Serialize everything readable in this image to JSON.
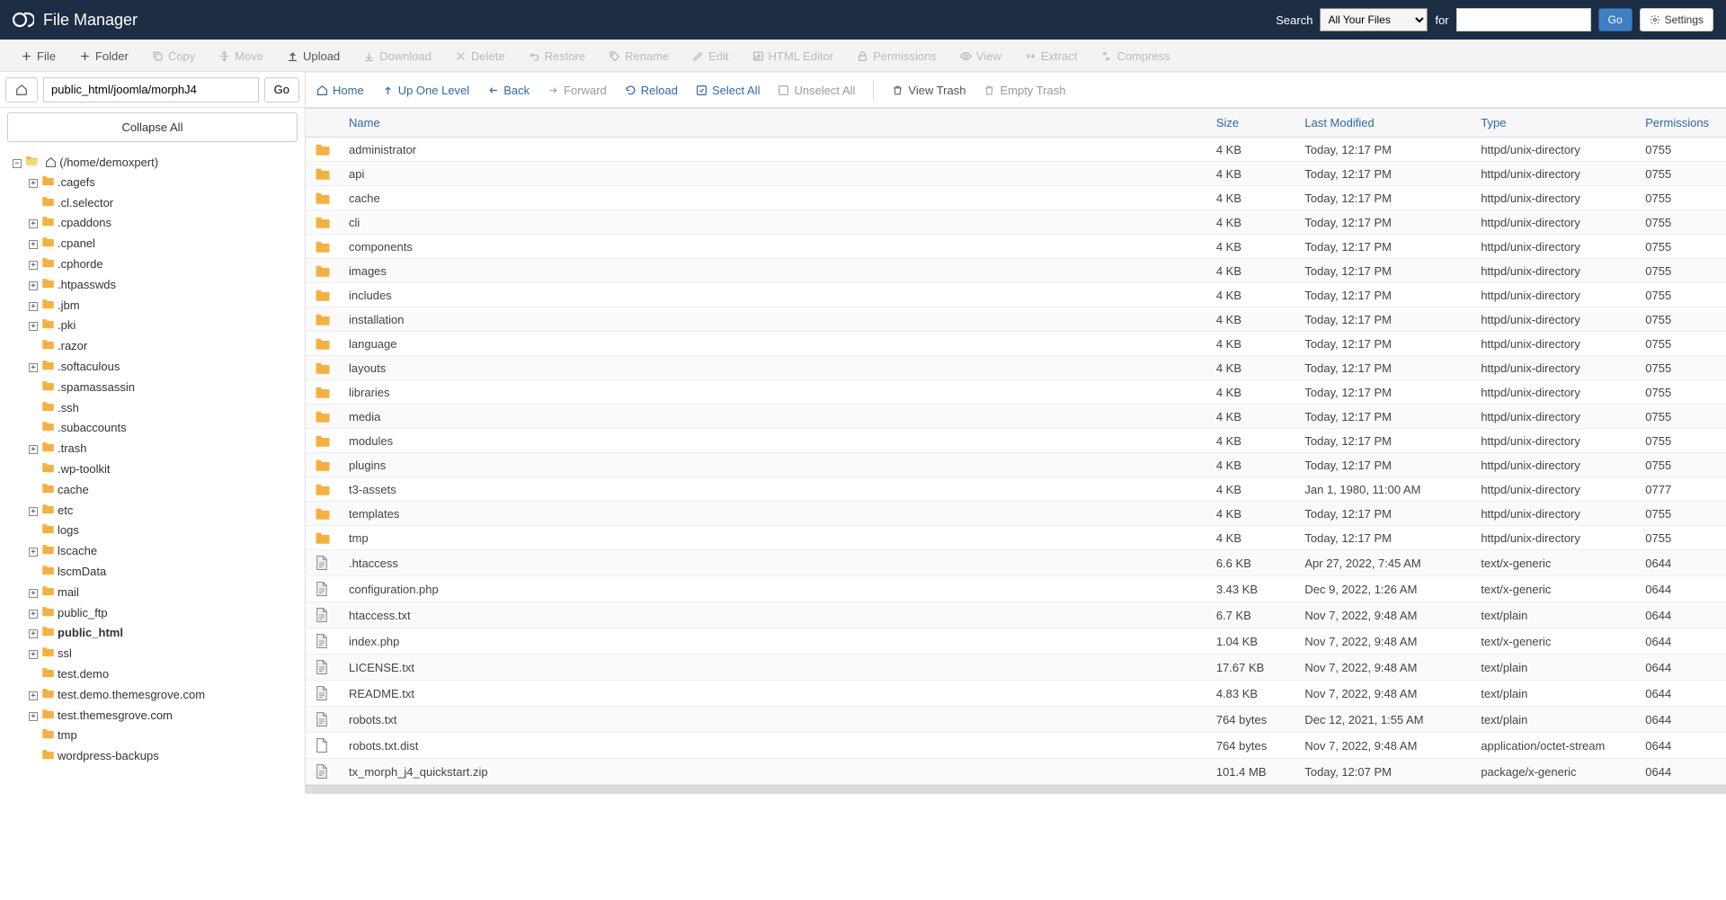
{
  "header": {
    "title": "File Manager",
    "search_label": "Search",
    "search_select_value": "All Your Files",
    "for_label": "for",
    "go": "Go",
    "settings": "Settings"
  },
  "toolbar": [
    {
      "label": "File",
      "icon": "plus",
      "enabled": true
    },
    {
      "label": "Folder",
      "icon": "plus",
      "enabled": true
    },
    {
      "label": "Copy",
      "icon": "copy",
      "enabled": false
    },
    {
      "label": "Move",
      "icon": "move",
      "enabled": false
    },
    {
      "label": "Upload",
      "icon": "upload",
      "enabled": true
    },
    {
      "label": "Download",
      "icon": "download",
      "enabled": false
    },
    {
      "label": "Delete",
      "icon": "x",
      "enabled": false
    },
    {
      "label": "Restore",
      "icon": "undo",
      "enabled": false
    },
    {
      "label": "Rename",
      "icon": "tag",
      "enabled": false
    },
    {
      "label": "Edit",
      "icon": "pencil",
      "enabled": false
    },
    {
      "label": "HTML Editor",
      "icon": "edit",
      "enabled": false
    },
    {
      "label": "Permissions",
      "icon": "lock",
      "enabled": false
    },
    {
      "label": "View",
      "icon": "eye",
      "enabled": false
    },
    {
      "label": "Extract",
      "icon": "extract",
      "enabled": false
    },
    {
      "label": "Compress",
      "icon": "compress",
      "enabled": false
    }
  ],
  "path": {
    "value": "public_html/joomla/morphJ4",
    "go": "Go",
    "collapse_all": "Collapse All"
  },
  "tree": {
    "root": {
      "label": "(/home/demoxpert)",
      "expanded": true,
      "icon": "folder-open-home"
    },
    "children": [
      {
        "label": ".cagefs",
        "expander": "+"
      },
      {
        "label": ".cl.selector",
        "expander": ""
      },
      {
        "label": ".cpaddons",
        "expander": "+"
      },
      {
        "label": ".cpanel",
        "expander": "+"
      },
      {
        "label": ".cphorde",
        "expander": "+"
      },
      {
        "label": ".htpasswds",
        "expander": "+"
      },
      {
        "label": ".jbm",
        "expander": "+"
      },
      {
        "label": ".pki",
        "expander": "+"
      },
      {
        "label": ".razor",
        "expander": ""
      },
      {
        "label": ".softaculous",
        "expander": "+"
      },
      {
        "label": ".spamassassin",
        "expander": ""
      },
      {
        "label": ".ssh",
        "expander": ""
      },
      {
        "label": ".subaccounts",
        "expander": ""
      },
      {
        "label": ".trash",
        "expander": "+"
      },
      {
        "label": ".wp-toolkit",
        "expander": ""
      },
      {
        "label": "cache",
        "expander": ""
      },
      {
        "label": "etc",
        "expander": "+"
      },
      {
        "label": "logs",
        "expander": ""
      },
      {
        "label": "lscache",
        "expander": "+"
      },
      {
        "label": "lscmData",
        "expander": ""
      },
      {
        "label": "mail",
        "expander": "+"
      },
      {
        "label": "public_ftp",
        "expander": "+"
      },
      {
        "label": "public_html",
        "expander": "+",
        "bold": true
      },
      {
        "label": "ssl",
        "expander": "+"
      },
      {
        "label": "test.demo",
        "expander": ""
      },
      {
        "label": "test.demo.themesgrove.com",
        "expander": "+"
      },
      {
        "label": "test.themesgrove.com",
        "expander": "+"
      },
      {
        "label": "tmp",
        "expander": ""
      },
      {
        "label": "wordpress-backups",
        "expander": ""
      }
    ]
  },
  "secondbar": [
    {
      "label": "Home",
      "icon": "home",
      "style": "link"
    },
    {
      "label": "Up One Level",
      "icon": "up",
      "style": "link"
    },
    {
      "label": "Back",
      "icon": "left",
      "style": "link"
    },
    {
      "label": "Forward",
      "icon": "right",
      "style": "muted"
    },
    {
      "label": "Reload",
      "icon": "reload",
      "style": "link"
    },
    {
      "label": "Select All",
      "icon": "check",
      "style": "link"
    },
    {
      "label": "Unselect All",
      "icon": "uncheck",
      "style": "muted"
    },
    {
      "type": "sep"
    },
    {
      "label": "View Trash",
      "icon": "trash",
      "style": "dark"
    },
    {
      "label": "Empty Trash",
      "icon": "trash",
      "style": "muted"
    }
  ],
  "columns": {
    "name": "Name",
    "size": "Size",
    "modified": "Last Modified",
    "type": "Type",
    "permissions": "Permissions"
  },
  "files": [
    {
      "name": "administrator",
      "size": "4 KB",
      "modified": "Today, 12:17 PM",
      "type": "httpd/unix-directory",
      "perm": "0755",
      "icon": "folder"
    },
    {
      "name": "api",
      "size": "4 KB",
      "modified": "Today, 12:17 PM",
      "type": "httpd/unix-directory",
      "perm": "0755",
      "icon": "folder"
    },
    {
      "name": "cache",
      "size": "4 KB",
      "modified": "Today, 12:17 PM",
      "type": "httpd/unix-directory",
      "perm": "0755",
      "icon": "folder"
    },
    {
      "name": "cli",
      "size": "4 KB",
      "modified": "Today, 12:17 PM",
      "type": "httpd/unix-directory",
      "perm": "0755",
      "icon": "folder"
    },
    {
      "name": "components",
      "size": "4 KB",
      "modified": "Today, 12:17 PM",
      "type": "httpd/unix-directory",
      "perm": "0755",
      "icon": "folder"
    },
    {
      "name": "images",
      "size": "4 KB",
      "modified": "Today, 12:17 PM",
      "type": "httpd/unix-directory",
      "perm": "0755",
      "icon": "folder"
    },
    {
      "name": "includes",
      "size": "4 KB",
      "modified": "Today, 12:17 PM",
      "type": "httpd/unix-directory",
      "perm": "0755",
      "icon": "folder"
    },
    {
      "name": "installation",
      "size": "4 KB",
      "modified": "Today, 12:17 PM",
      "type": "httpd/unix-directory",
      "perm": "0755",
      "icon": "folder"
    },
    {
      "name": "language",
      "size": "4 KB",
      "modified": "Today, 12:17 PM",
      "type": "httpd/unix-directory",
      "perm": "0755",
      "icon": "folder"
    },
    {
      "name": "layouts",
      "size": "4 KB",
      "modified": "Today, 12:17 PM",
      "type": "httpd/unix-directory",
      "perm": "0755",
      "icon": "folder"
    },
    {
      "name": "libraries",
      "size": "4 KB",
      "modified": "Today, 12:17 PM",
      "type": "httpd/unix-directory",
      "perm": "0755",
      "icon": "folder"
    },
    {
      "name": "media",
      "size": "4 KB",
      "modified": "Today, 12:17 PM",
      "type": "httpd/unix-directory",
      "perm": "0755",
      "icon": "folder"
    },
    {
      "name": "modules",
      "size": "4 KB",
      "modified": "Today, 12:17 PM",
      "type": "httpd/unix-directory",
      "perm": "0755",
      "icon": "folder"
    },
    {
      "name": "plugins",
      "size": "4 KB",
      "modified": "Today, 12:17 PM",
      "type": "httpd/unix-directory",
      "perm": "0755",
      "icon": "folder"
    },
    {
      "name": "t3-assets",
      "size": "4 KB",
      "modified": "Jan 1, 1980, 11:00 AM",
      "type": "httpd/unix-directory",
      "perm": "0777",
      "icon": "folder"
    },
    {
      "name": "templates",
      "size": "4 KB",
      "modified": "Today, 12:17 PM",
      "type": "httpd/unix-directory",
      "perm": "0755",
      "icon": "folder"
    },
    {
      "name": "tmp",
      "size": "4 KB",
      "modified": "Today, 12:17 PM",
      "type": "httpd/unix-directory",
      "perm": "0755",
      "icon": "folder"
    },
    {
      "name": ".htaccess",
      "size": "6.6 KB",
      "modified": "Apr 27, 2022, 7:45 AM",
      "type": "text/x-generic",
      "perm": "0644",
      "icon": "file"
    },
    {
      "name": "configuration.php",
      "size": "3.43 KB",
      "modified": "Dec 9, 2022, 1:26 AM",
      "type": "text/x-generic",
      "perm": "0644",
      "icon": "file"
    },
    {
      "name": "htaccess.txt",
      "size": "6.7 KB",
      "modified": "Nov 7, 2022, 9:48 AM",
      "type": "text/plain",
      "perm": "0644",
      "icon": "file"
    },
    {
      "name": "index.php",
      "size": "1.04 KB",
      "modified": "Nov 7, 2022, 9:48 AM",
      "type": "text/x-generic",
      "perm": "0644",
      "icon": "file"
    },
    {
      "name": "LICENSE.txt",
      "size": "17.67 KB",
      "modified": "Nov 7, 2022, 9:48 AM",
      "type": "text/plain",
      "perm": "0644",
      "icon": "file"
    },
    {
      "name": "README.txt",
      "size": "4.83 KB",
      "modified": "Nov 7, 2022, 9:48 AM",
      "type": "text/plain",
      "perm": "0644",
      "icon": "file"
    },
    {
      "name": "robots.txt",
      "size": "764 bytes",
      "modified": "Dec 12, 2021, 1:55 AM",
      "type": "text/plain",
      "perm": "0644",
      "icon": "file"
    },
    {
      "name": "robots.txt.dist",
      "size": "764 bytes",
      "modified": "Nov 7, 2022, 9:48 AM",
      "type": "application/octet-stream",
      "perm": "0644",
      "icon": "file-blank"
    },
    {
      "name": "tx_morph_j4_quickstart.zip",
      "size": "101.4 MB",
      "modified": "Today, 12:07 PM",
      "type": "package/x-generic",
      "perm": "0644",
      "icon": "file"
    }
  ]
}
